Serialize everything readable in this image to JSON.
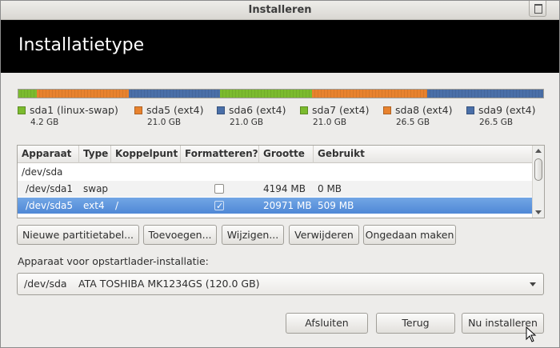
{
  "window": {
    "title": "Installeren"
  },
  "header": {
    "title": "Installatietype"
  },
  "partitions": [
    {
      "name": "sda1 (linux-swap)",
      "size": "4.2 GB",
      "color": "#7bbb2e"
    },
    {
      "name": "sda5 (ext4)",
      "size": "21.0 GB",
      "color": "#e8822e"
    },
    {
      "name": "sda6 (ext4)",
      "size": "21.0 GB",
      "color": "#4a6fa8"
    },
    {
      "name": "sda7 (ext4)",
      "size": "21.0 GB",
      "color": "#7bbb2e"
    },
    {
      "name": "sda8 (ext4)",
      "size": "26.5 GB",
      "color": "#e8822e"
    },
    {
      "name": "sda9 (ext4)",
      "size": "26.5 GB",
      "color": "#4a6fa8"
    }
  ],
  "partition_bar_values_gb": [
    4.2,
    21.0,
    21.0,
    21.0,
    26.5,
    26.5
  ],
  "table": {
    "headers": [
      "Apparaat",
      "Type",
      "Koppelpunt",
      "Formatteren?",
      "Grootte",
      "Gebruikt"
    ],
    "rows": [
      {
        "device": "/dev/sda",
        "type": "",
        "mount": "",
        "format": null,
        "size": "",
        "used": ""
      },
      {
        "device": "/dev/sda1",
        "type": "swap",
        "mount": "",
        "format": false,
        "size": "4194 MB",
        "used": "0 MB"
      },
      {
        "device": "/dev/sda5",
        "type": "ext4",
        "mount": "/",
        "format": true,
        "size": "20971 MB",
        "used": "509 MB",
        "selected": true
      }
    ]
  },
  "actions": {
    "new_table": "Nieuwe partitietabel...",
    "add": "Toevoegen...",
    "change": "Wijzigen...",
    "delete": "Verwijderen",
    "undo": "Ongedaan maken"
  },
  "bootloader": {
    "label": "Apparaat voor opstartlader-installatie:",
    "device": "/dev/sda",
    "disk": "ATA TOSHIBA MK1234GS (120.0 GB)"
  },
  "footer": {
    "quit": "Afsluiten",
    "back": "Terug",
    "install": "Nu installeren"
  },
  "colors": {
    "header_bg": "#000000",
    "selection": "#5a93dc"
  }
}
